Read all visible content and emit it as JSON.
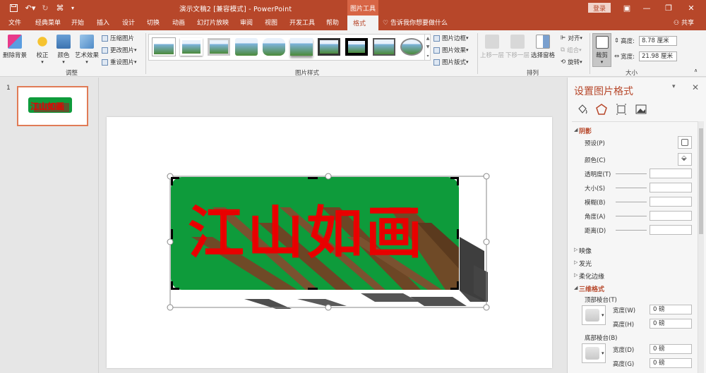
{
  "title_bar": {
    "document_title": "演示文稿2 [兼容模式] - PowerPoint",
    "context_tab": "图片工具",
    "login_label": "登录"
  },
  "tabs": [
    "文件",
    "经典菜单",
    "开始",
    "插入",
    "设计",
    "切换",
    "动画",
    "幻灯片放映",
    "审阅",
    "视图",
    "开发工具",
    "帮助",
    "格式"
  ],
  "active_tab": "格式",
  "tell_me": "告诉我你想要做什么",
  "share_label": "共享",
  "ribbon": {
    "remove_bg": "删除背景",
    "correct": "校正",
    "color": "颜色",
    "artistic": "艺术效果",
    "compress": "压缩图片",
    "change_pic": "更改图片",
    "reset_pic": "重设图片",
    "group_adjust": "调整",
    "group_style": "图片样式",
    "border": "图片边框",
    "effects": "图片效果",
    "layout": "图片版式",
    "bring_forward": "上移一层",
    "send_backward": "下移一层",
    "selection_pane": "选择窗格",
    "align": "对齐",
    "group": "组合",
    "rotate": "旋转",
    "group_arrange": "排列",
    "crop": "裁剪",
    "height_label": "高度:",
    "height_value": "8.78 厘米",
    "width_label": "宽度:",
    "width_value": "21.98 厘米",
    "group_size": "大小"
  },
  "slides": [
    {
      "number": "1"
    }
  ],
  "slide_content": {
    "text": "江山如画",
    "bg_color": "#0e9b3b",
    "text_color": "#e80000",
    "extrude_color": "#7a5230"
  },
  "format_pane": {
    "title": "设置图片格式",
    "sections": {
      "shadow": "阴影",
      "reflection": "映像",
      "glow": "发光",
      "soft_edges": "柔化边缘",
      "format_3d": "三维格式"
    },
    "shadow_rows": {
      "preset": "预设(P)",
      "color": "颜色(C)",
      "transparency": "透明度(T)",
      "size": "大小(S)",
      "blur": "模糊(B)",
      "angle": "角度(A)",
      "distance": "距离(D)"
    },
    "top_bevel": "顶部棱台(T)",
    "bottom_bevel": "底部棱台(B)",
    "width_w": "宽度(W)",
    "height_h": "高度(H)",
    "width_d": "宽度(D)",
    "height_g": "高度(G)",
    "zero_pt": "0 磅"
  }
}
